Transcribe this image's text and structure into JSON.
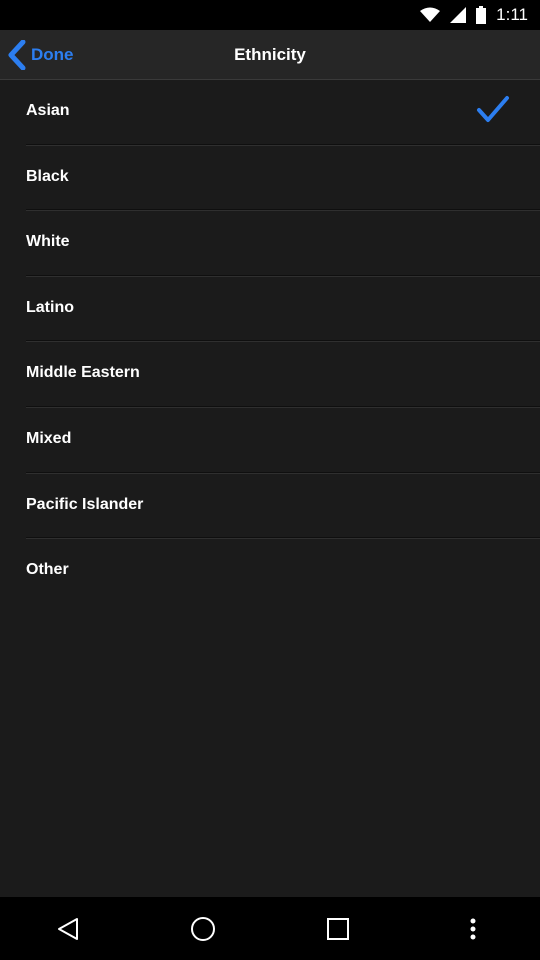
{
  "status_bar": {
    "time": "1:11"
  },
  "header": {
    "back_label": "Done",
    "title": "Ethnicity"
  },
  "options": [
    {
      "label": "Asian",
      "selected": true
    },
    {
      "label": "Black",
      "selected": false
    },
    {
      "label": "White",
      "selected": false
    },
    {
      "label": "Latino",
      "selected": false
    },
    {
      "label": "Middle Eastern",
      "selected": false
    },
    {
      "label": "Mixed",
      "selected": false
    },
    {
      "label": "Pacific Islander",
      "selected": false
    },
    {
      "label": "Other",
      "selected": false
    }
  ],
  "colors": {
    "accent": "#2c7ef0",
    "background": "#1b1b1b",
    "header": "#262626"
  },
  "nav_bar": {
    "icons": [
      "back-icon",
      "home-icon",
      "recents-icon",
      "more-icon"
    ]
  }
}
